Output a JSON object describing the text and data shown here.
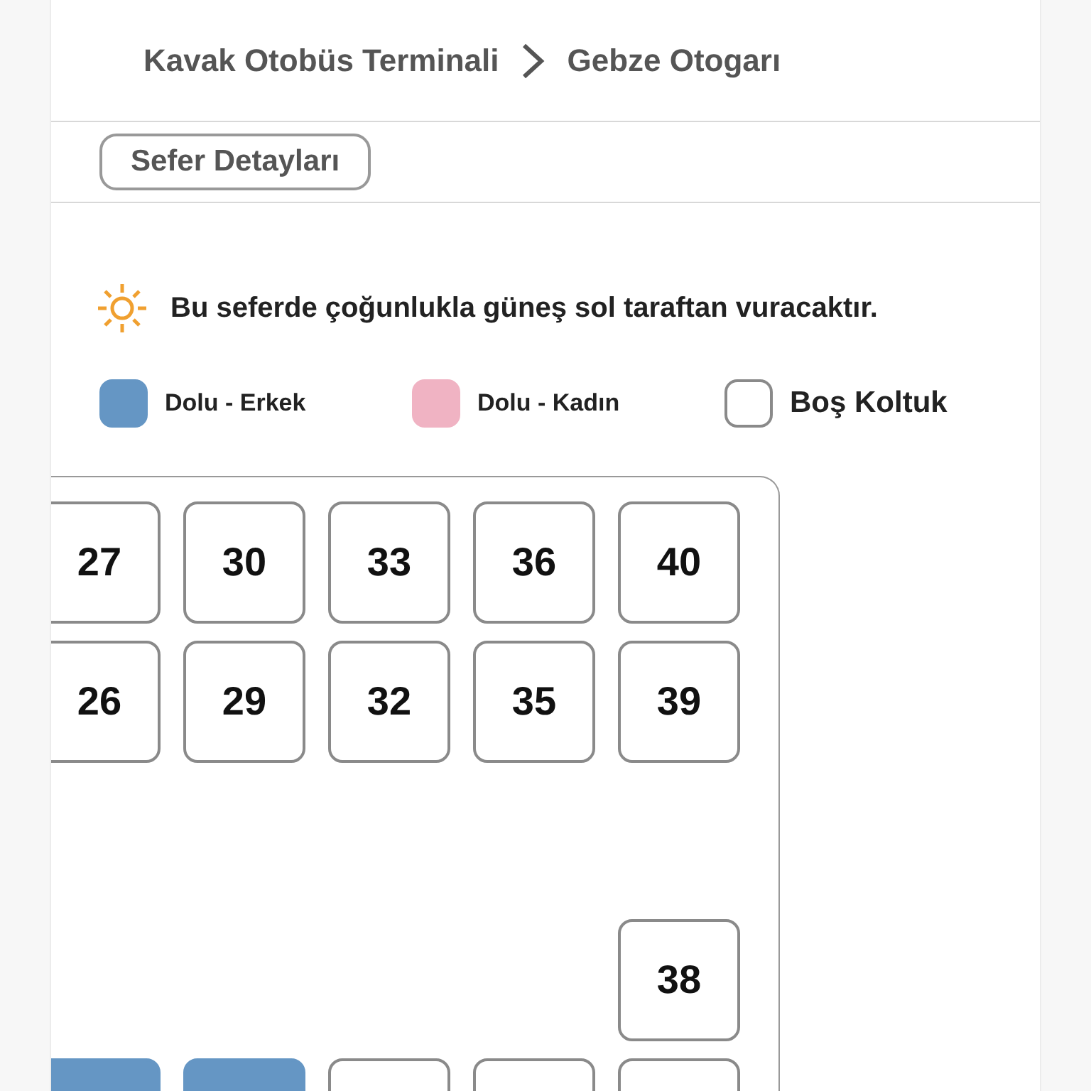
{
  "route": {
    "from": "Kavak Otobüs Terminali",
    "to": "Gebze Otogarı"
  },
  "details_button": "Sefer Detayları",
  "sun_notice": "Bu seferde çoğunlukla güneş sol taraftan vuracaktır.",
  "legend": [
    {
      "label": "Dolu - Erkek",
      "kind": "male"
    },
    {
      "label": "Dolu - Kadın",
      "kind": "female"
    },
    {
      "label": "Boş Koltuk",
      "kind": "empty"
    }
  ],
  "seat_rows": [
    [
      {
        "number": "27",
        "kind": "empty"
      },
      {
        "number": "30",
        "kind": "empty"
      },
      {
        "number": "33",
        "kind": "empty"
      },
      {
        "number": "36",
        "kind": "empty"
      },
      {
        "number": "40",
        "kind": "empty"
      }
    ],
    [
      {
        "number": "26",
        "kind": "empty"
      },
      {
        "number": "29",
        "kind": "empty"
      },
      {
        "number": "32",
        "kind": "empty"
      },
      {
        "number": "35",
        "kind": "empty"
      },
      {
        "number": "39",
        "kind": "empty"
      }
    ],
    [
      null,
      null,
      null,
      null,
      null
    ],
    [
      null,
      null,
      null,
      null,
      {
        "number": "38",
        "kind": "empty"
      }
    ],
    [
      {
        "kind": "male"
      },
      {
        "kind": "male"
      },
      {
        "kind": "empty"
      },
      {
        "kind": "empty"
      },
      {
        "kind": "empty"
      }
    ]
  ]
}
